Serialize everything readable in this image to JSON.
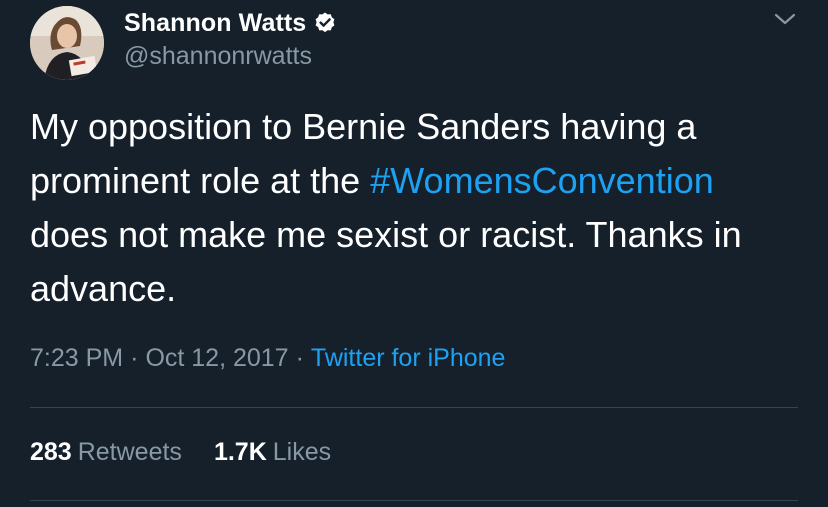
{
  "author": {
    "display_name": "Shannon Watts",
    "handle": "@shannonrwatts",
    "verified": true
  },
  "tweet": {
    "text_before_hashtag": "My opposition to Bernie Sanders having a prominent role at the ",
    "hashtag": "#WomensConvention",
    "text_after_hashtag": " does not make me sexist or racist. Thanks in advance."
  },
  "meta": {
    "time": "7:23 PM",
    "separator": "·",
    "date": "Oct 12, 2017",
    "source": "Twitter for iPhone"
  },
  "stats": {
    "retweets_count": "283",
    "retweets_label": "Retweets",
    "likes_count": "1.7K",
    "likes_label": "Likes"
  },
  "icons": {
    "verified": "verified-badge-icon",
    "caret": "chevron-down-icon"
  },
  "colors": {
    "background": "#15202b",
    "primary_text": "#ffffff",
    "secondary_text": "#8899a6",
    "link": "#1da1f2",
    "divider": "#38444d"
  }
}
